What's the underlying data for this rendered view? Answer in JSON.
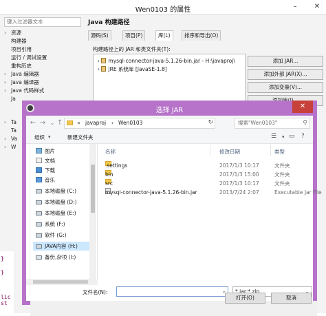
{
  "window": {
    "title": "Wen0103 的属性",
    "filter_placeholder": "键入过滤器文本",
    "nav": [
      "资源",
      "构建器",
      "项目引用",
      "运行 / 调试设置",
      "重构历史",
      "Java 编辑器",
      "Java 编译器",
      "Java 代码样式",
      "Ja",
      "Ta",
      "Ta",
      "Va",
      "W"
    ],
    "heading": "Java 构建路径",
    "tabs": [
      "源码(S)",
      "项目(P)",
      "库(L)",
      "排序和导出(O)"
    ],
    "lib_title": "构建路径上的 JAR 和类文件夹(T):",
    "libs": [
      "mysql-connector-java-5.1.26-bin.jar - H:\\javaproj\\",
      "JRE 系统库 [JavaSE-1.8]"
    ],
    "buttons": [
      "添加 JAR...",
      "添加外部 JAR(X)...",
      "添加变量(V)...",
      "添加库(I)..."
    ],
    "code": [
      "}",
      "}",
      "lic st"
    ]
  },
  "dialog": {
    "title": "选择 JAR",
    "close_glyph": "✕",
    "breadcrumb": [
      "«",
      "javaproj",
      "›",
      "Wen0103"
    ],
    "search_placeholder": "搜索\"Wen0103\"",
    "organize": "组织",
    "new_folder": "新建文件夹",
    "sidebar": [
      {
        "label": "图片",
        "icon": "pic"
      },
      {
        "label": "文档",
        "icon": "doc"
      },
      {
        "label": "下载",
        "icon": "dl"
      },
      {
        "label": "音乐",
        "icon": "mus"
      },
      {
        "label": "本地磁盘 (C:)",
        "icon": "drv"
      },
      {
        "label": "本地磁盘 (D:)",
        "icon": "drv"
      },
      {
        "label": "本地磁盘 (E:)",
        "icon": "drv"
      },
      {
        "label": "系统 (F:)",
        "icon": "drv"
      },
      {
        "label": "软件 (G:)",
        "icon": "drv"
      },
      {
        "label": "JAVA内容 (H:)",
        "icon": "drv"
      },
      {
        "label": "备份,杂项 (I:)",
        "icon": "net"
      }
    ],
    "columns": {
      "name": "名称",
      "date": "修改日期",
      "type": "类型"
    },
    "files": [
      {
        "name": ".settings",
        "date": "2017/1/3 10:17",
        "type": "文件夹",
        "icon": "folder"
      },
      {
        "name": "bin",
        "date": "2017/1/3 15:00",
        "type": "文件夹",
        "icon": "folder"
      },
      {
        "name": "src",
        "date": "2017/1/3 10:17",
        "type": "文件夹",
        "icon": "folder"
      },
      {
        "name": "mysql-connector-java-5.1.26-bin.jar",
        "date": "2013/7/24 2:07",
        "type": "Executable Jar File",
        "icon": "jar"
      }
    ],
    "filename_label": "文件名(N):",
    "filename_value": "",
    "filter_value": "*.jar;*.zip",
    "open": "打开(O)",
    "cancel": "取消"
  }
}
